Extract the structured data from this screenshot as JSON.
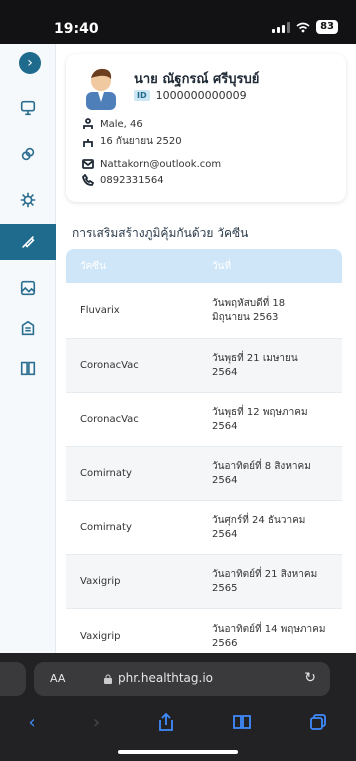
{
  "status": {
    "time": "19:40",
    "battery": "83"
  },
  "profile": {
    "name": "นาย ณัฐกรณ์ ศรีบุรบย์",
    "id_badge": "ID",
    "id": "1000000000009",
    "gender_age": "Male, 46",
    "birthdate": "16 กันยายน 2520",
    "email": "Nattakorn@outlook.com",
    "phone": "0892331564"
  },
  "section_title": "การเสริมสร้างภูมิคุ้มกันด้วย วัคซีน",
  "table": {
    "headers": [
      "วัคซีน",
      "วันที่"
    ],
    "rows": [
      {
        "vaccine": "Fluvarix",
        "date": "วันพฤหัสบดีที่ 18 มิถุนายน 2563"
      },
      {
        "vaccine": "CoronacVac",
        "date": "วันพุธที่ 21 เมษายน 2564"
      },
      {
        "vaccine": "CoronacVac",
        "date": "วันพุธที่ 12 พฤษภาคม 2564"
      },
      {
        "vaccine": "Comirnaty",
        "date": "วันอาทิตย์ที่ 8 สิงหาคม 2564"
      },
      {
        "vaccine": "Comirnaty",
        "date": "วันศุกร์ที่ 24 ธันวาคม 2564"
      },
      {
        "vaccine": "Vaxigrip",
        "date": "วันอาทิตย์ที่ 21 สิงหาคม 2565"
      },
      {
        "vaccine": "Vaxigrip",
        "date": "วันอาทิตย์ที่ 14 พฤษภาคม 2566"
      }
    ]
  },
  "browser": {
    "aa": "AA",
    "url": "phr.healthtag.io"
  },
  "colors": {
    "primary": "#1e6b8d",
    "header_bg": "#cfe6f8",
    "accent": "#3f8cff"
  },
  "icons": [
    "chevron-right-icon",
    "monitor-icon",
    "link-icon",
    "virus-icon",
    "syringe-icon",
    "image-icon",
    "building-icon",
    "book-icon"
  ]
}
